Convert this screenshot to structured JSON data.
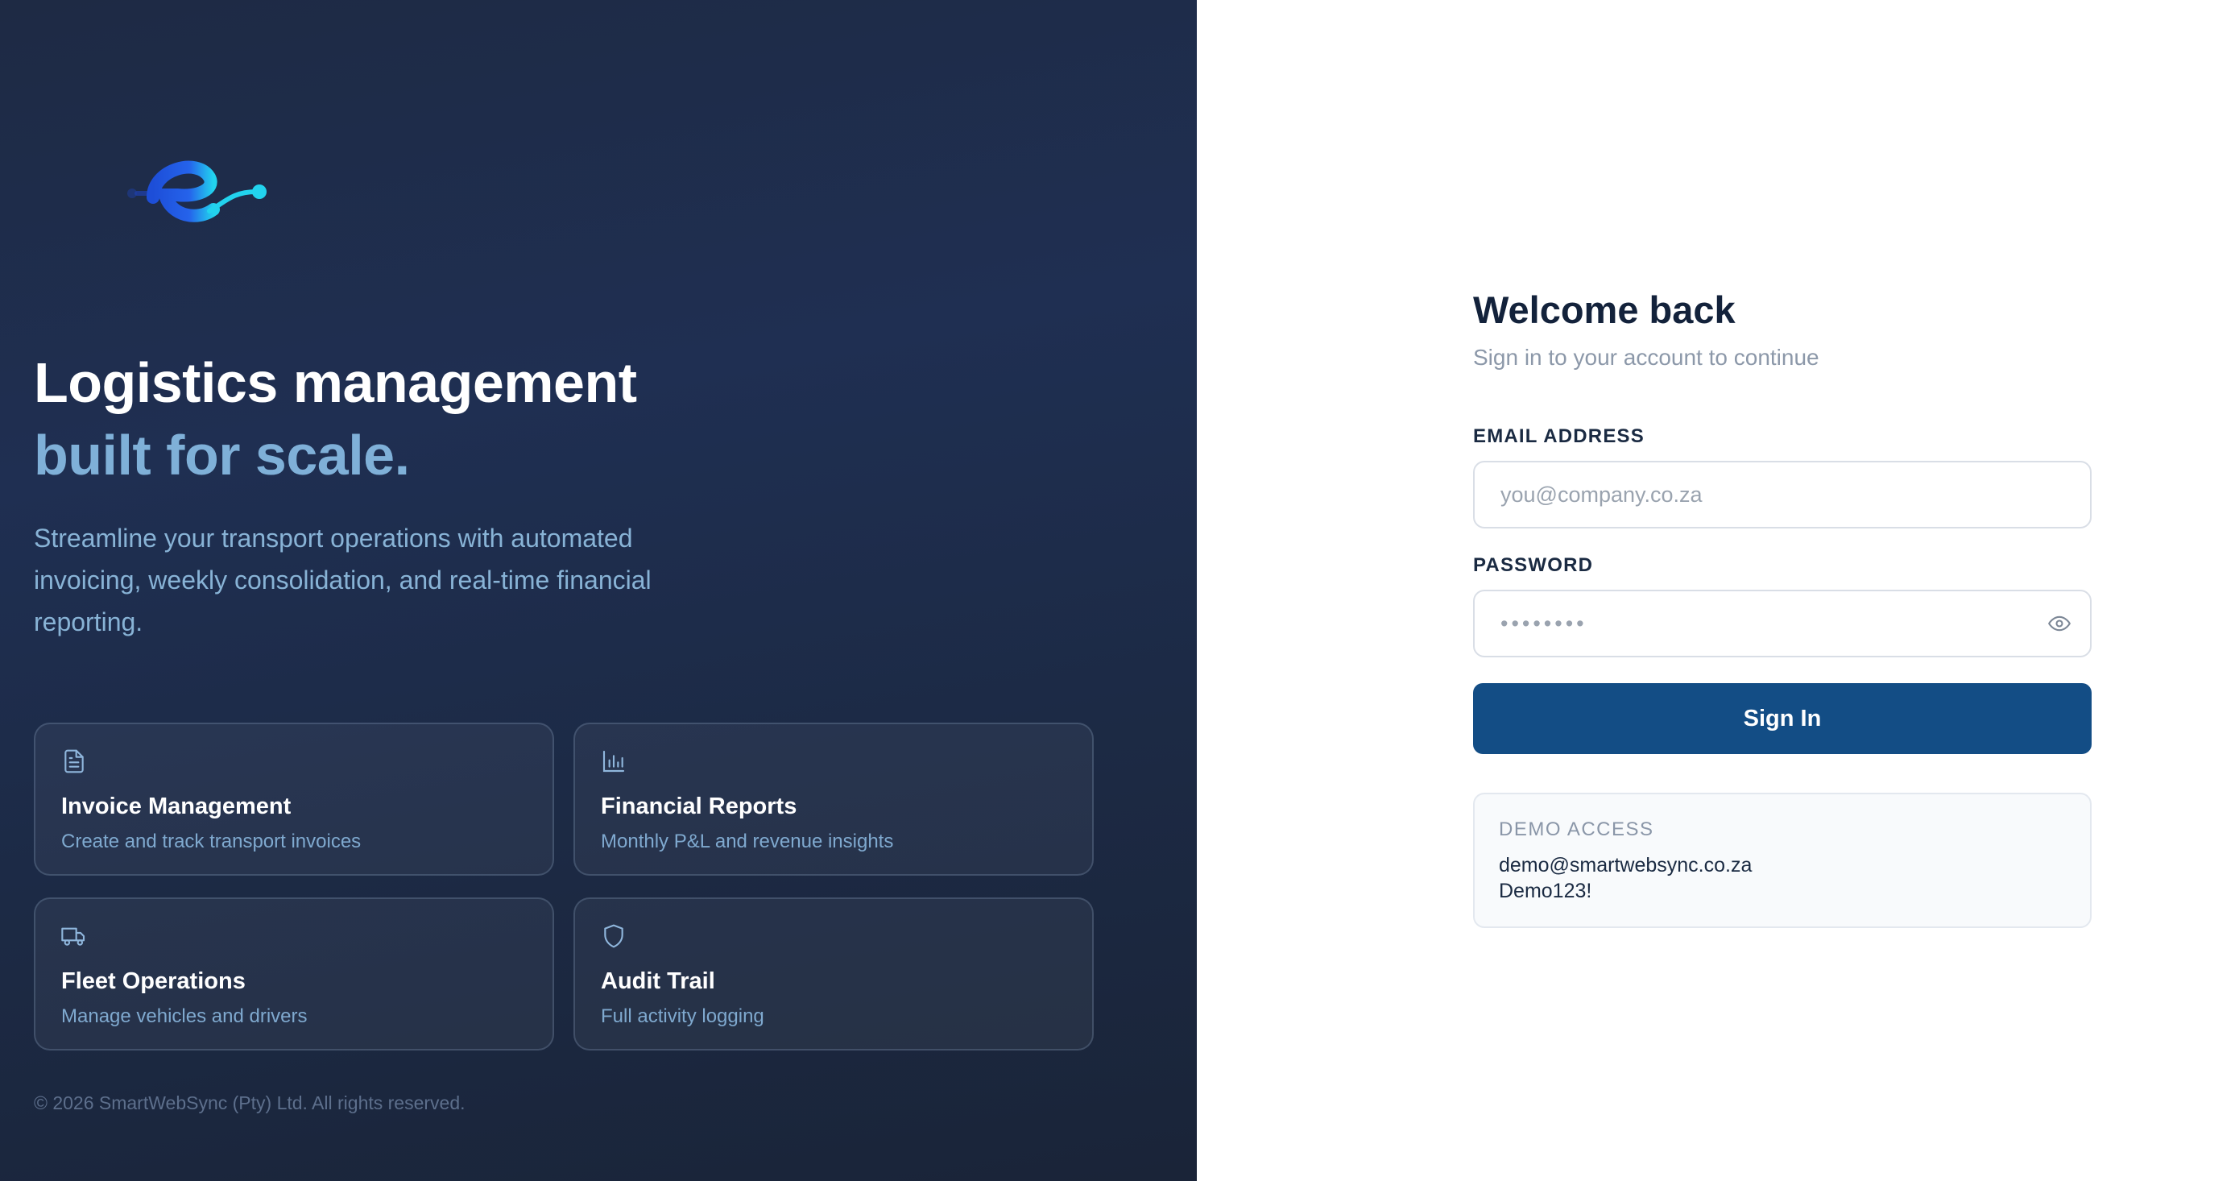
{
  "brand": {
    "logo_icon": "brand-e-logo",
    "colors": {
      "logo_dark": "#1d4ed8",
      "logo_light": "#22d3ee"
    }
  },
  "hero": {
    "headline": "Logistics management",
    "headline_accent": "built for scale.",
    "description": "Streamline your transport operations with automated invoicing, weekly consolidation, and real-time financial reporting."
  },
  "features": [
    {
      "icon": "document-icon",
      "title": "Invoice Management",
      "subtitle": "Create and track transport invoices"
    },
    {
      "icon": "bar-chart-icon",
      "title": "Financial Reports",
      "subtitle": "Monthly P&L and revenue insights"
    },
    {
      "icon": "truck-icon",
      "title": "Fleet Operations",
      "subtitle": "Manage vehicles and drivers"
    },
    {
      "icon": "shield-icon",
      "title": "Audit Trail",
      "subtitle": "Full activity logging"
    }
  ],
  "footer": {
    "copyright": "© 2026 SmartWebSync (Pty) Ltd. All rights reserved."
  },
  "login": {
    "title": "Welcome back",
    "subtitle": "Sign in to your account to continue",
    "email_label": "EMAIL ADDRESS",
    "email_placeholder": "you@company.co.za",
    "password_label": "PASSWORD",
    "password_value": "••••••••",
    "sign_in_label": "Sign In",
    "colors": {
      "primary": "#134d85"
    }
  },
  "demo": {
    "heading": "DEMO ACCESS",
    "email": "demo@smartwebsync.co.za",
    "password": "Demo123!"
  }
}
